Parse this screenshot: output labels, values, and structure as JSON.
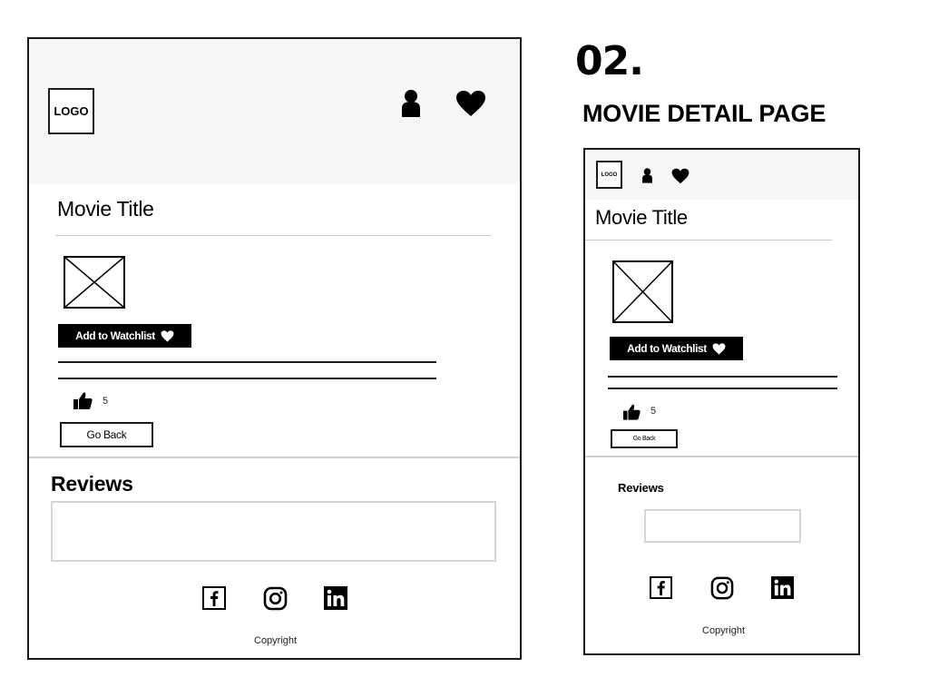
{
  "section": {
    "number": "02.",
    "title": "MOVIE DETAIL PAGE"
  },
  "large": {
    "logo": "LOGO",
    "movie_title": "Movie Title",
    "watchlist_label": "Add to Watchlist",
    "likes": "5",
    "go_back": "Go Back",
    "reviews": "Reviews",
    "copyright": "Copyright"
  },
  "small": {
    "logo": "LOGO",
    "movie_title": "Movie Title",
    "watchlist_label": "Add to Watchlist",
    "likes": "5",
    "go_back": "Go Back",
    "reviews": "Reviews",
    "copyright": "Copyright"
  },
  "icons": [
    "user-icon",
    "heart-icon",
    "thumbs-up-icon",
    "facebook-icon",
    "instagram-icon",
    "linkedin-icon",
    "image-placeholder-icon"
  ]
}
